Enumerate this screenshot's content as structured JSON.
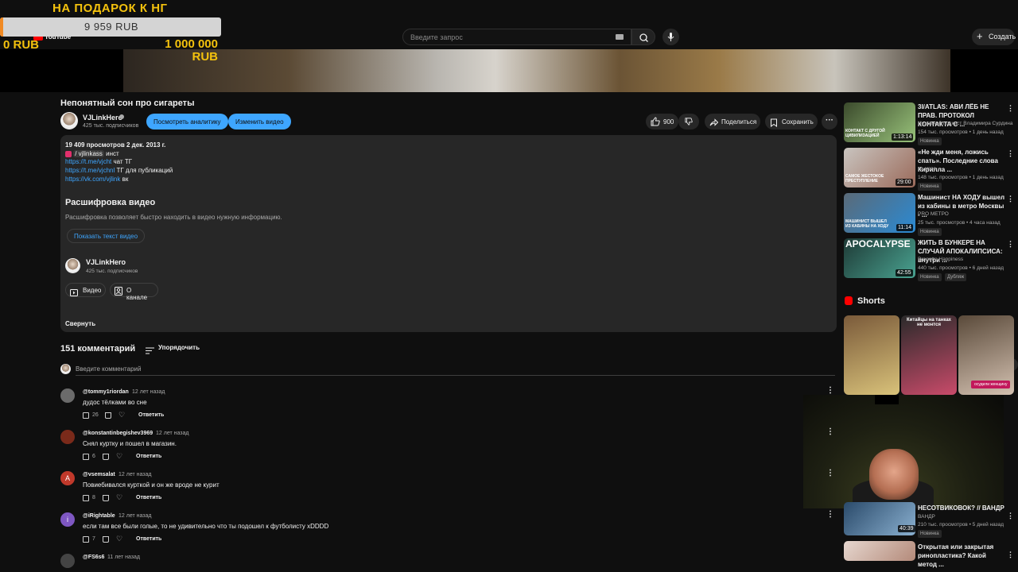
{
  "donation": {
    "title": "НА ПОДАРОК К НГ",
    "current": "9 959 RUB",
    "min": "0 RUB",
    "max": "1 000 000 RUB",
    "progress_fraction": 0.00996,
    "accent": "#f4c20d"
  },
  "header": {
    "logo_label": "YouTube",
    "search_placeholder": "Введите запрос",
    "create_label": "Создать",
    "icons": [
      "keyboard-icon",
      "search-icon",
      "mic-icon",
      "plus-icon"
    ]
  },
  "video": {
    "title": "Непонятный сон про сигареты",
    "channel": "VJLinkHero",
    "subscribers": "425 тыс. подписчиков",
    "analytics_label": "Посмотреть аналитику",
    "edit_label": "Изменить видео",
    "likes": "900",
    "share_label": "Поделиться",
    "save_label": "Сохранить"
  },
  "description": {
    "stats": "19 409 просмотров  2 дек. 2013 г.",
    "line1_link": "/ vjlinkass",
    "line1_suffix": "инст",
    "line2_link": "https://t.me/vjcht",
    "line2_suffix": "чат ТГ",
    "line3_link": "https://t.me/vjchnl",
    "line3_suffix": "ТГ для публикаций",
    "line4_link": "https://vk.com/vjlink",
    "line4_suffix": "вк",
    "transcript_title": "Расшифровка видео",
    "transcript_text": "Расшифровка позволяет быстро находить в видео нужную информацию.",
    "transcript_button": "Показать текст видео",
    "channel_name": "VJLinkHero",
    "channel_subs": "425 тыс. подписчиков",
    "videos_button": "Видео",
    "about_button": "О канале",
    "collapse_label": "Свернуть"
  },
  "comments": {
    "count_label": "151 комментарий",
    "sort_label": "Упорядочить",
    "input_placeholder": "Введите комментарий",
    "reply_label": "Ответить",
    "items": [
      {
        "author": "@tommy1riordan",
        "time": "12 лет назад",
        "text": "дудос тёлками во сне",
        "likes": "26",
        "avatar_color": "#6b6b6b",
        "initial": ""
      },
      {
        "author": "@konstantinbegishev3969",
        "time": "12 лет назад",
        "text": "Снял куртку и пошел в магазин.",
        "likes": "6",
        "avatar_color": "#7a2a1a",
        "initial": ""
      },
      {
        "author": "@vsemsalat",
        "time": "12 лет назад",
        "text": "Повиебивался курткой и он же вроде не курит",
        "likes": "8",
        "avatar_color": "#c0392b",
        "initial": "A"
      },
      {
        "author": "@iRightable",
        "time": "12 лет назад",
        "text": "если там все были голые, то не удивительно что ты подошел к футболисту xDDDD",
        "likes": "7",
        "avatar_color": "#7e57c2",
        "initial": "i"
      },
      {
        "author": "@FS6s6",
        "time": "11 лет назад",
        "text": "",
        "likes": "",
        "avatar_color": "#444",
        "initial": ""
      }
    ]
  },
  "related": [
    {
      "title": "3I/ATLAS: АВИ ЛЁБ НЕ ПРАВ. ПРОТОКОЛ КОНТАКТА С ...",
      "channel": "Неземной подкаст Владимира Сурдина",
      "meta": "154 тыс. просмотров • 1 день назад",
      "badge": "Новинка",
      "duration": "1:13:14",
      "thumb_text": "КОНТАКТ С ДРУГОЙ ЦИВИЛИЗАЦИЕЙ",
      "colors": [
        "#3b4a2c",
        "#98c27a"
      ]
    },
    {
      "title": "«Не жди меня, ложись спать». Последние слова Кирилла ...",
      "channel": "во мгле.",
      "meta": "148 тыс. просмотров • 1 день назад",
      "badge": "Новинка",
      "duration": "29:00",
      "thumb_text": "САМОЕ ЖЕСТОКОЕ ПРЕСТУПЛЕНИЕ",
      "colors": [
        "#c9c4bf",
        "#9a6a5a"
      ]
    },
    {
      "title": "Машинист НА ХОДУ вышел из кабины в метро Москвы - ...",
      "channel": "PRO МЕТРО",
      "meta": "25 тыс. просмотров • 4 часа назад",
      "badge": "Новинка",
      "duration": "11:14",
      "thumb_text": "МАШИНИСТ ВЫШЕЛ ИЗ КАБИНЫ НА ХОДУ",
      "colors": [
        "#5a6a78",
        "#2b8ad3"
      ]
    },
    {
      "title": "ЖИТЬ В БУНКЕРЕ НА СЛУЧАЙ АПОКАЛИПСИСА: внутри ...",
      "channel": "Progetto Happiness",
      "meta": "440 тыс. просмотров • 6 дней назад",
      "badge": "Новинка",
      "badge2": "Дубляж",
      "duration": "42:55",
      "thumb_text": "APOCALYPSE",
      "colors": [
        "#1e3a36",
        "#4aa391"
      ]
    }
  ],
  "shorts": {
    "title": "Shorts",
    "items": [
      {
        "text": "",
        "colors": [
          "#7a5a3a",
          "#d9c27a"
        ]
      },
      {
        "text": "Китайцы на танках не монтся",
        "colors": [
          "#2a2a2a",
          "#c94b6a"
        ]
      },
      {
        "text": "",
        "colors": [
          "#5a4a3a",
          "#d3c0b0"
        ]
      }
    ],
    "chip_label": "осудили женщину"
  },
  "related_bottom": [
    {
      "title": "НЕСОТВИКОВОК? // ВАНДР",
      "channel": "ВАНДР",
      "meta": "210 тыс. просмотров • 5 дней назад",
      "badge": "Новинка",
      "duration": "40:39",
      "colors": [
        "#2a4a6a",
        "#8ab0d0"
      ]
    },
    {
      "title": "Открытая или закрытая ринопластика? Какой метод ...",
      "channel": "",
      "meta": "",
      "badge": "",
      "duration": "",
      "colors": [
        "#e6d7cf",
        "#b48a7a"
      ]
    }
  ]
}
